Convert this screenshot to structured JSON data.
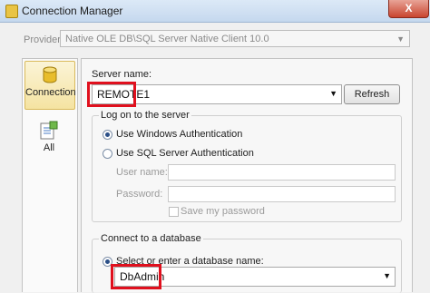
{
  "window": {
    "title": "Connection Manager",
    "close_glyph": "X"
  },
  "provider": {
    "label": "Provider:",
    "value": "Native OLE DB\\SQL Server Native Client 10.0"
  },
  "sidebar": {
    "items": [
      {
        "label": "Connection",
        "icon": "database-icon",
        "selected": true
      },
      {
        "label": "All",
        "icon": "properties-icon",
        "selected": false
      }
    ]
  },
  "server": {
    "label": "Server name:",
    "value": "REMOTE1",
    "refresh_label": "Refresh"
  },
  "logon": {
    "group_title": "Log on to the server",
    "windows_auth_label": "Use Windows Authentication",
    "sql_auth_label": "Use SQL Server Authentication",
    "selected": "windows",
    "user_name_label": "User name:",
    "user_name_value": "",
    "password_label": "Password:",
    "password_value": "",
    "save_password_label": "Save my password"
  },
  "database": {
    "group_title": "Connect to a database",
    "select_label": "Select or enter a database name:",
    "value": "DbAdmin"
  },
  "colors": {
    "highlight": "#e0101e",
    "selected_tab": "#f5e3a1"
  }
}
